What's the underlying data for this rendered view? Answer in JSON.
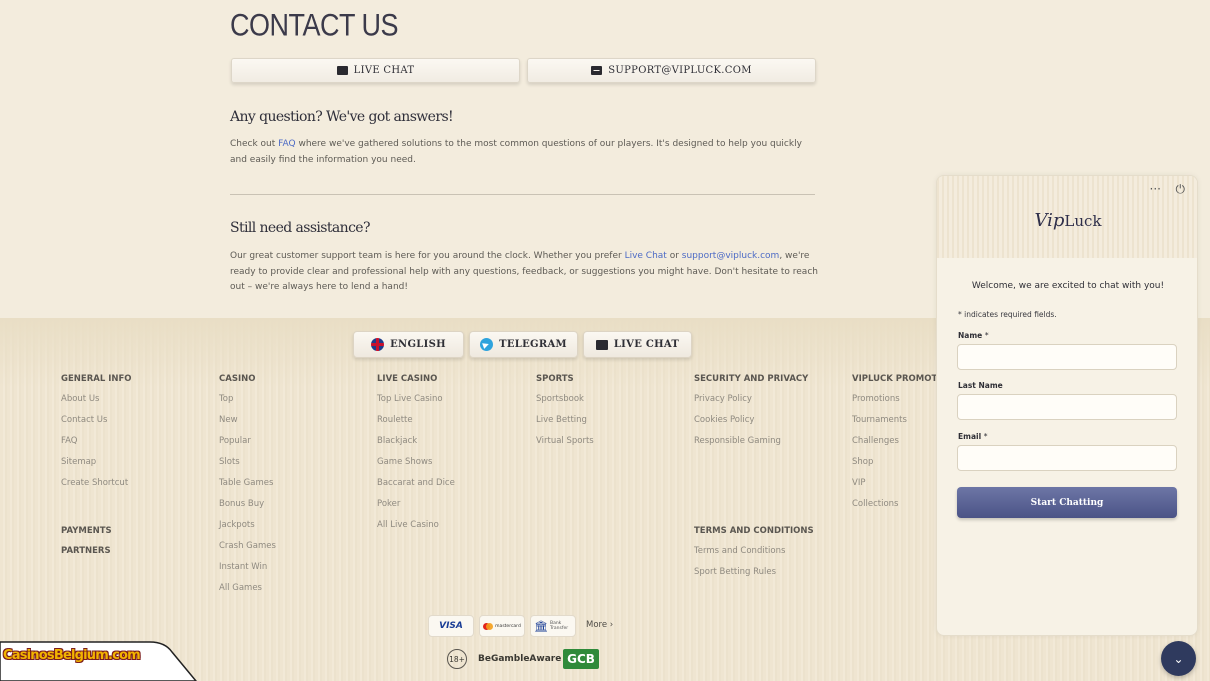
{
  "contact": {
    "title": "CONTACT US",
    "live_chat_label": "LIVE CHAT",
    "email_label": "SUPPORT@VIPLUCK.COM"
  },
  "faq_section": {
    "heading": "Any question? We've got answers!",
    "text_before": "Check out ",
    "faq_link": "FAQ",
    "text_after": " where we've gathered solutions to the most common questions of our players. It's designed to help you quickly and easily find the information you need."
  },
  "assist_section": {
    "heading": "Still need assistance?",
    "text_1": "Our great customer support team is here for you around the clock. Whether you prefer ",
    "live_chat_link": "Live Chat",
    "text_2": " or ",
    "email_link": "support@vipluck.com",
    "text_3": ", we're ready to provide clear and professional help with any questions, feedback, or suggestions you might have. Don't hesitate to reach out – we're always here to lend a hand!"
  },
  "footer_buttons": {
    "english": "ENGLISH",
    "telegram": "TELEGRAM",
    "live_chat": "LIVE CHAT"
  },
  "footer_columns": {
    "general": {
      "title": "GENERAL INFO",
      "items": [
        "About Us",
        "Contact Us",
        "FAQ",
        "Sitemap",
        "Create Shortcut"
      ]
    },
    "casino": {
      "title": "CASINO",
      "items": [
        "Top",
        "New",
        "Popular",
        "Slots",
        "Table Games",
        "Bonus Buy",
        "Jackpots",
        "Crash Games",
        "Instant Win",
        "All Games"
      ]
    },
    "live_casino": {
      "title": "LIVE CASINO",
      "items": [
        "Top Live Casino",
        "Roulette",
        "Blackjack",
        "Game Shows",
        "Baccarat and Dice",
        "Poker",
        "All Live Casino"
      ]
    },
    "sports": {
      "title": "SPORTS",
      "items": [
        "Sportsbook",
        "Live Betting",
        "Virtual Sports"
      ]
    },
    "security": {
      "title": "SECURITY AND PRIVACY",
      "items": [
        "Privacy Policy",
        "Cookies Policy",
        "Responsible Gaming"
      ]
    },
    "terms": {
      "title": "TERMS AND CONDITIONS",
      "items": [
        "Terms and Conditions",
        "Sport Betting Rules"
      ]
    },
    "promotions": {
      "title": "VIPLUCK PROMOTIONS",
      "items": [
        "Promotions",
        "Tournaments",
        "Challenges",
        "Shop",
        "VIP",
        "Collections"
      ]
    },
    "payments": {
      "title": "PAYMENTS"
    },
    "partners": {
      "title": "PARTNERS"
    }
  },
  "payments": {
    "visa": "VISA",
    "mastercard": "mastercard",
    "bank": "Bank Transfer",
    "more": "More"
  },
  "responsible": {
    "age": "18+",
    "begamble": "BeGambleAware",
    "gcb": "GCB"
  },
  "badge": {
    "text": "CasinosBelgium.com"
  },
  "chat_widget": {
    "logo_v": "Vip",
    "logo_rest": "Luck",
    "welcome": "Welcome, we are excited to chat with you!",
    "required_note": "* indicates required fields.",
    "name_label": "Name",
    "last_name_label": "Last Name",
    "email_label": "Email",
    "required_mark": "*",
    "start_button": "Start Chatting"
  },
  "colors": {
    "accent_link": "#4d6bc5",
    "chat_button": "#4b5386",
    "fab": "#2f3a5e"
  }
}
